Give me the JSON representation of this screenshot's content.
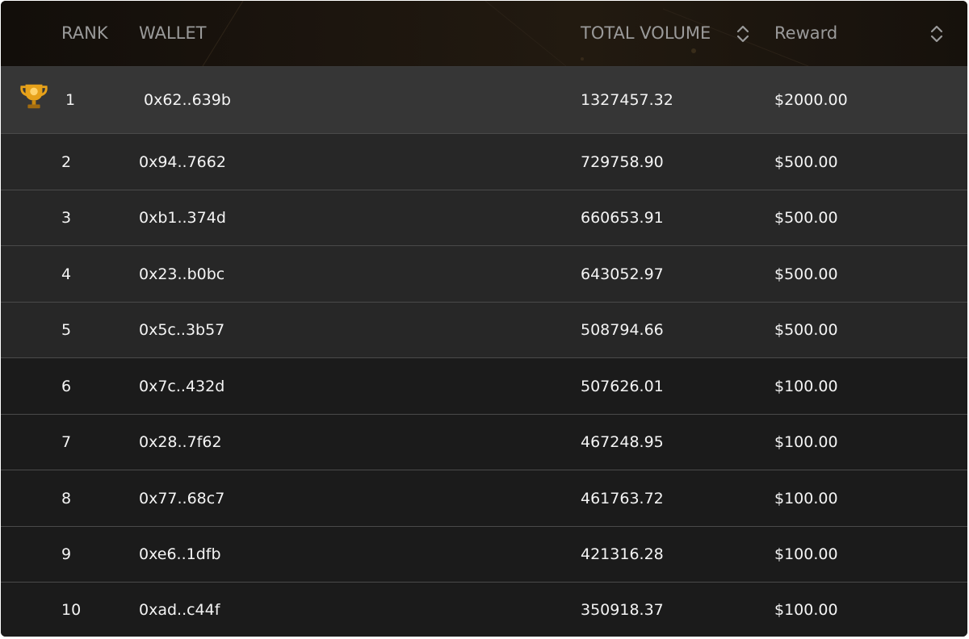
{
  "header": {
    "rank_label": "RANK",
    "wallet_label": "WALLET",
    "volume_label": "TOTAL VOLUME",
    "reward_label": "Reward"
  },
  "rows": [
    {
      "rank": "1",
      "wallet": "0x62..639b",
      "volume": "1327457.32",
      "reward": "$2000.00"
    },
    {
      "rank": "2",
      "wallet": "0x94..7662",
      "volume": "729758.90",
      "reward": "$500.00"
    },
    {
      "rank": "3",
      "wallet": "0xb1..374d",
      "volume": "660653.91",
      "reward": "$500.00"
    },
    {
      "rank": "4",
      "wallet": "0x23..b0bc",
      "volume": "643052.97",
      "reward": "$500.00"
    },
    {
      "rank": "5",
      "wallet": "0x5c..3b57",
      "volume": "508794.66",
      "reward": "$500.00"
    },
    {
      "rank": "6",
      "wallet": "0x7c..432d",
      "volume": "507626.01",
      "reward": "$100.00"
    },
    {
      "rank": "7",
      "wallet": "0x28..7f62",
      "volume": "467248.95",
      "reward": "$100.00"
    },
    {
      "rank": "8",
      "wallet": "0x77..68c7",
      "volume": "461763.72",
      "reward": "$100.00"
    },
    {
      "rank": "9",
      "wallet": "0xe6..1dfb",
      "volume": "421316.28",
      "reward": "$100.00"
    },
    {
      "rank": "10",
      "wallet": "0xad..c44f",
      "volume": "350918.37",
      "reward": "$100.00"
    }
  ],
  "colors": {
    "first_place_row": "#363636",
    "top_tier_row": "#272727",
    "standard_row": "#1b1b1b",
    "trophy_gold": "#e6a11a"
  },
  "icons": {
    "first_place": "trophy-icon",
    "sort": "sort-updown-icon"
  }
}
